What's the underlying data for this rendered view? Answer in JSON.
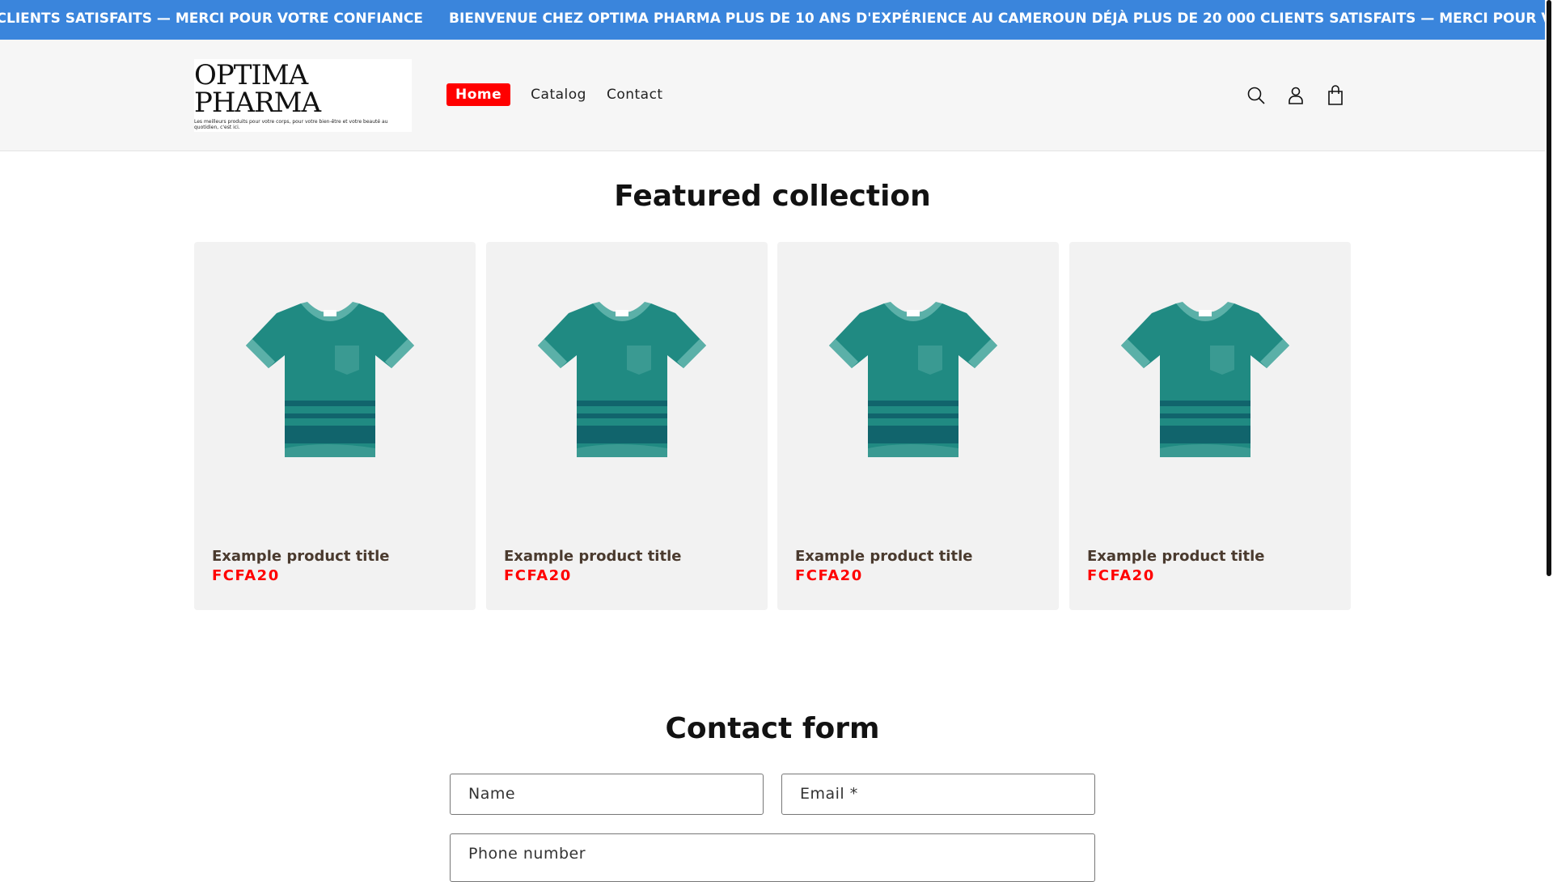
{
  "announcement": "BIENVENUE CHEZ OPTIMA PHARMA PLUS DE 10 ANS D'EXPÉRIENCE AU CAMEROUN DÉJÀ PLUS DE 20 000 CLIENTS SATISFAITS — MERCI POUR VOTRE CONFIANCE",
  "logo": {
    "title": "OPTIMA PHARMA",
    "tagline": "Les meilleurs produits pour votre corps, pour votre bien-être et votre beauté au quotidien, c'est ici."
  },
  "nav": [
    {
      "label": "Home"
    },
    {
      "label": "Catalog"
    },
    {
      "label": "Contact"
    }
  ],
  "featured": {
    "title": "Featured collection",
    "products": [
      {
        "title": "Example product title",
        "price": "FCFA20"
      },
      {
        "title": "Example product title",
        "price": "FCFA20"
      },
      {
        "title": "Example product title",
        "price": "FCFA20"
      },
      {
        "title": "Example product title",
        "price": "FCFA20"
      }
    ]
  },
  "contact": {
    "title": "Contact form",
    "name_placeholder": "Name",
    "email_placeholder": "Email *",
    "phone_placeholder": "Phone number"
  }
}
